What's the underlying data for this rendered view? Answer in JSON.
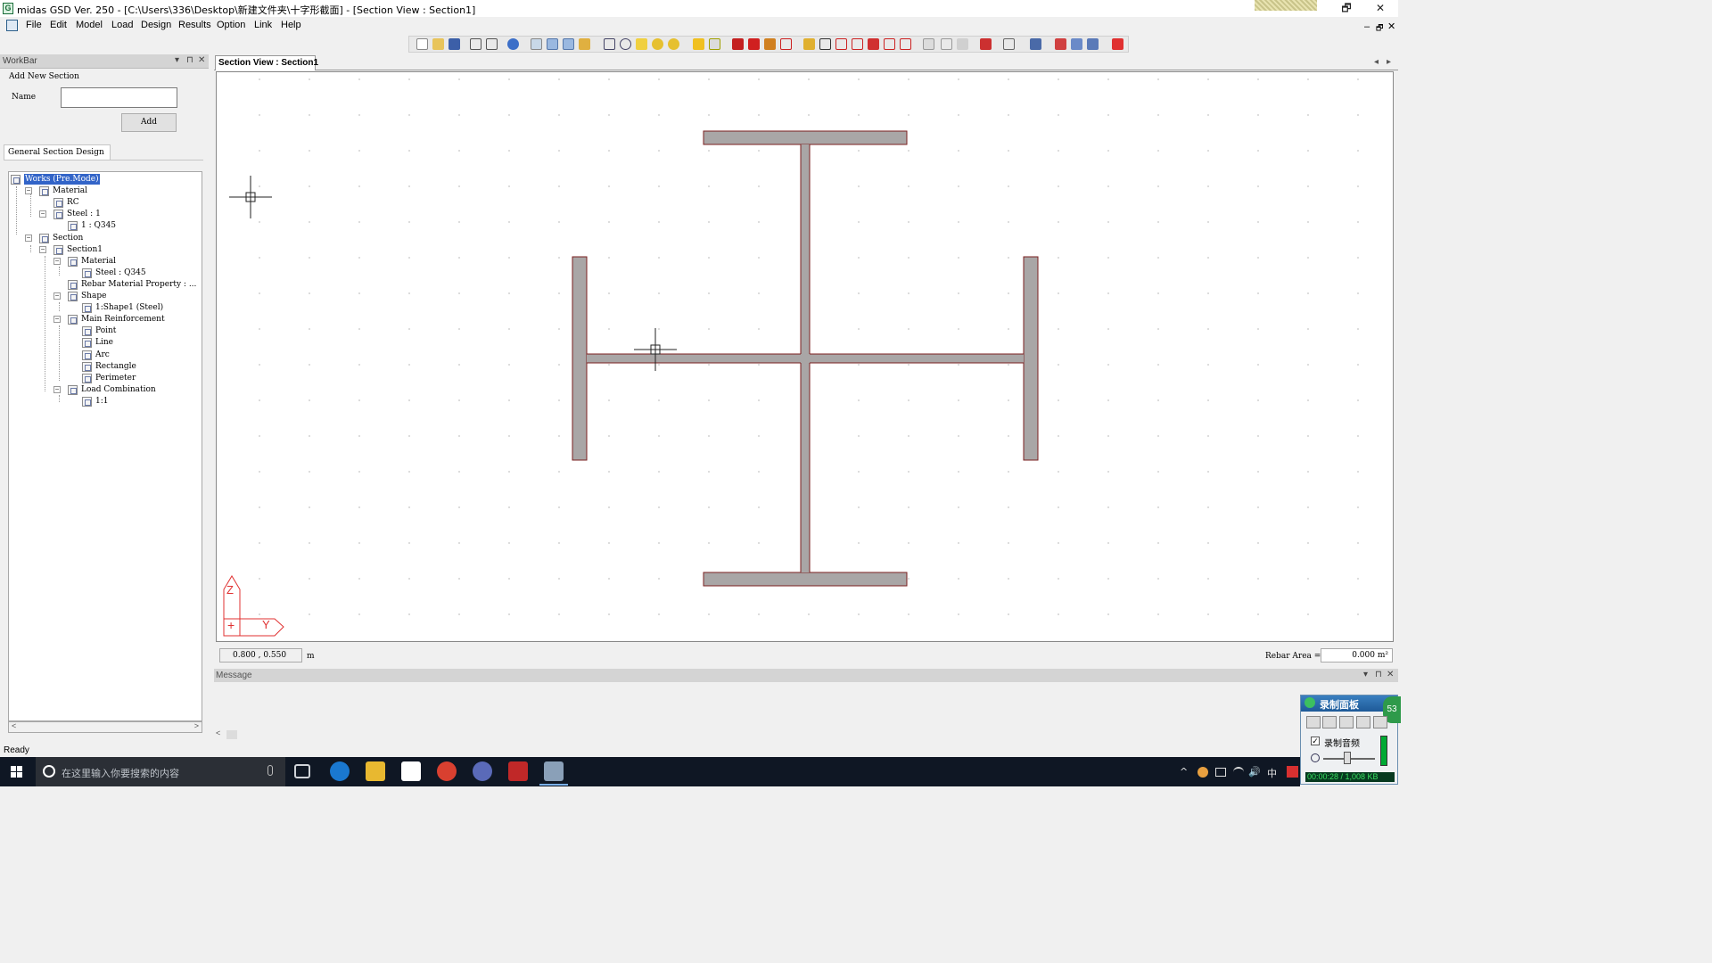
{
  "window": {
    "title": "midas GSD Ver. 250 - [C:\\Users\\336\\Desktop\\新建文件夹\\十字形截面] - [Section View : Section1]",
    "buttons": [
      "🗗",
      "✕"
    ]
  },
  "menu": [
    "File",
    "Edit",
    "Model",
    "Load",
    "Design",
    "Results",
    "Option",
    "Link",
    "Help"
  ],
  "menu_right": [
    "–",
    "🗗",
    "✕"
  ],
  "workbar": {
    "title": "WorkBar",
    "header_icons": [
      "▾",
      "⊓",
      "✕"
    ],
    "add_section_label": "Add New Section",
    "name_label": "Name",
    "name_value": "",
    "add_button": "Add",
    "tab": "General Section Design"
  },
  "tree": [
    {
      "label": "Works (Pre.Mode)",
      "level": 0,
      "selected": true,
      "toggle": ""
    },
    {
      "label": "Material",
      "level": 1,
      "toggle": "−"
    },
    {
      "label": "RC",
      "level": 2,
      "toggle": ""
    },
    {
      "label": "Steel : 1",
      "level": 2,
      "toggle": "−"
    },
    {
      "label": "1 : Q345",
      "level": 3,
      "toggle": ""
    },
    {
      "label": "Section",
      "level": 1,
      "toggle": "−"
    },
    {
      "label": "Section1",
      "level": 2,
      "toggle": "−"
    },
    {
      "label": "Material",
      "level": 3,
      "toggle": "−"
    },
    {
      "label": "Steel : Q345",
      "level": 4,
      "toggle": ""
    },
    {
      "label": "Rebar Material Property : ...",
      "level": 3,
      "toggle": ""
    },
    {
      "label": "Shape",
      "level": 3,
      "toggle": "−"
    },
    {
      "label": "1:Shape1 (Steel)",
      "level": 4,
      "toggle": ""
    },
    {
      "label": "Main Reinforcement",
      "level": 3,
      "toggle": "−"
    },
    {
      "label": "Point",
      "level": 4,
      "toggle": ""
    },
    {
      "label": "Line",
      "level": 4,
      "toggle": ""
    },
    {
      "label": "Arc",
      "level": 4,
      "toggle": ""
    },
    {
      "label": "Rectangle",
      "level": 4,
      "toggle": ""
    },
    {
      "label": "Perimeter",
      "level": 4,
      "toggle": ""
    },
    {
      "label": "Load Combination",
      "level": 3,
      "toggle": "−"
    },
    {
      "label": "1:1",
      "level": 4,
      "toggle": ""
    }
  ],
  "view": {
    "tab": "Section View : Section1",
    "nav_arrows": [
      "◂",
      "▸"
    ],
    "axis_z": "Z",
    "axis_y": "Y",
    "axis_origin": "+",
    "coordinates": "0.800 , 0.550",
    "coordinate_unit": "m",
    "rebar_area_label": "Rebar Area =",
    "rebar_area_value": "0.000 m²"
  },
  "message": {
    "title": "Message",
    "header_icons": [
      "▾",
      "⊓",
      "✕"
    ]
  },
  "status": "Ready",
  "recorder": {
    "title": "录制面板",
    "badge": "53",
    "audio_label": "录制音频",
    "audio_checked": "✓",
    "timer": "00:00:28 / 1,008 KB"
  },
  "taskbar": {
    "search_placeholder": "在这里输入你要搜索的内容",
    "tray_ime": "中",
    "tray_icons": [
      "^",
      "🔊",
      "中"
    ]
  },
  "colors": {
    "steel_fill": "#a9a6a6",
    "steel_outline": "#7a1f1f",
    "axis": "#e03030",
    "selection": "#3264c8"
  }
}
